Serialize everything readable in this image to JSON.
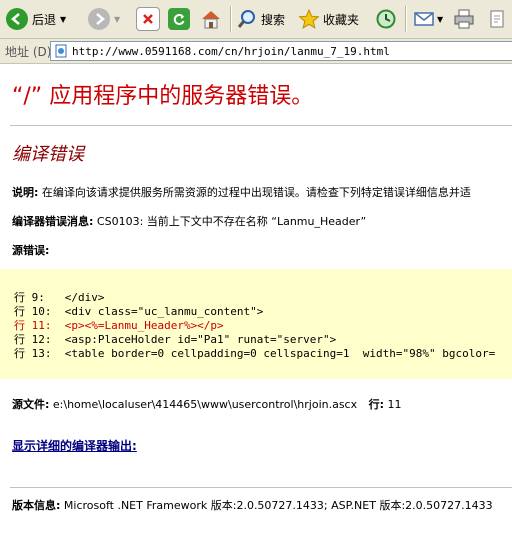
{
  "toolbar": {
    "back_label": "后退",
    "search_label": "搜索",
    "favorites_label": "收藏夹"
  },
  "address": {
    "label": "地址 (D)",
    "url": "http://www.0591168.com/cn/hrjoin/lanmu_7_19.html"
  },
  "error_page": {
    "title": "“/” 应用程序中的服务器错误。",
    "subtitle": "编译错误",
    "description_label": "说明:",
    "description_text": "在编译向该请求提供服务所需资源的过程中出现错误。请检查下列特定错误详细信息并适",
    "compiler_msg_label": "编译器错误消息:",
    "compiler_msg_text": "CS0103: 当前上下文中不存在名称 “Lanmu_Header”",
    "source_error_label": "源错误:",
    "code_lines": [
      "行 9:   </div>",
      "行 10:  <div class=\"uc_lanmu_content\">",
      "行 11:  <p><%=Lanmu_Header%></p>",
      "行 12:  <asp:PlaceHolder id=\"Pa1\" runat=\"server\">",
      "行 13:  <table border=0 cellpadding=0 cellspacing=1  width=\"98%\" bgcolor="
    ],
    "source_file_label": "源文件:",
    "source_file_path": "e:\\home\\localuser\\414465\\www\\usercontrol\\hrjoin.ascx",
    "line_label": "行:",
    "line_number": "11",
    "details_link": "显示详细的编译器输出:",
    "version_label": "版本信息:",
    "version_text": "Microsoft .NET Framework 版本:2.0.50727.1433; ASP.NET 版本:2.0.50727.1433"
  },
  "colors": {
    "error_red": "#cc0000",
    "subtitle_maroon": "#8b0000",
    "code_bg": "#ffffcc",
    "link_blue": "#000080"
  }
}
